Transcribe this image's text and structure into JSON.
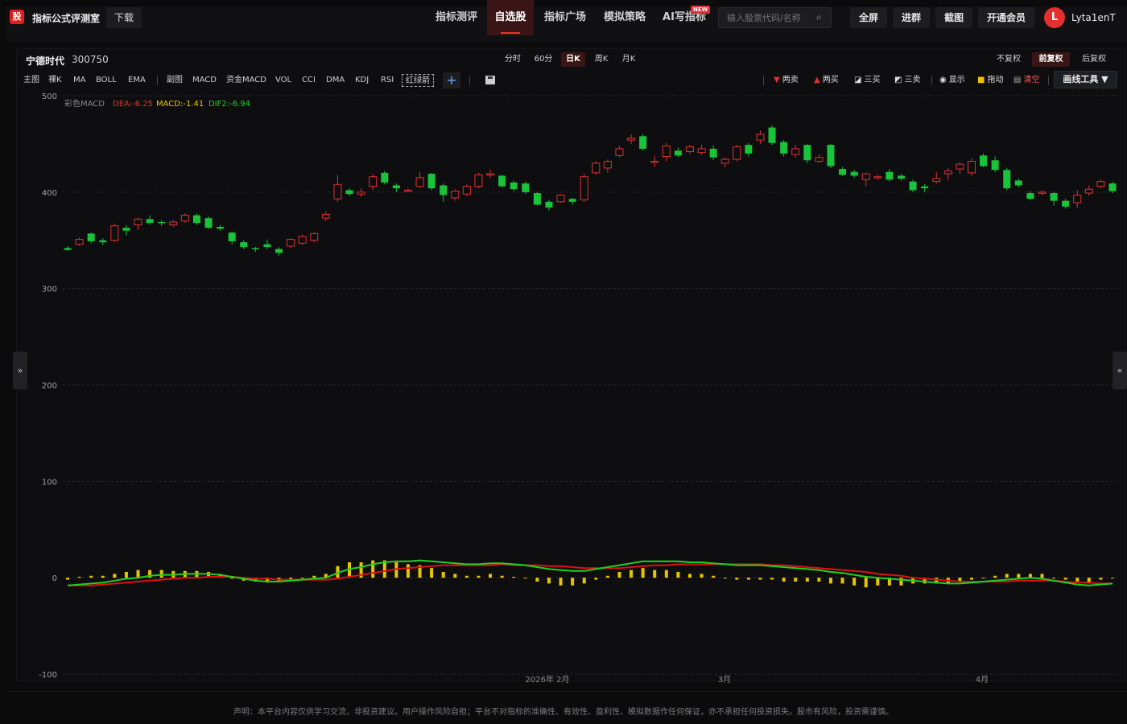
{
  "header": {
    "logo_char": "股",
    "site_title": "指标公式评测室",
    "download_label": "下载",
    "nav": [
      {
        "label": "指标测评",
        "active": false
      },
      {
        "label": "自选股",
        "active": true
      },
      {
        "label": "指标广场",
        "active": false
      },
      {
        "label": "模拟策略",
        "active": false
      },
      {
        "label": "AI写指标",
        "active": false
      }
    ],
    "new_badge": "NEW",
    "search_placeholder": "输入股票代码/名称",
    "buttons": [
      "全屏",
      "进群",
      "截图",
      "开通会员"
    ],
    "avatar_letter": "L",
    "username": "Lyta1enT"
  },
  "stock": {
    "name": "宁德时代",
    "code": "300750"
  },
  "periods": [
    {
      "label": "分时",
      "active": false
    },
    {
      "label": "60分",
      "active": false
    },
    {
      "label": "日K",
      "active": true
    },
    {
      "label": "周K",
      "active": false
    },
    {
      "label": "月K",
      "active": false
    }
  ],
  "adjust": [
    {
      "label": "不复权",
      "active": false
    },
    {
      "label": "前复权",
      "active": true
    },
    {
      "label": "后复权",
      "active": false
    }
  ],
  "indicators_main": [
    "主图",
    "裸K",
    "MA",
    "BOLL",
    "EMA"
  ],
  "indicators_sub": [
    "副图",
    "MACD",
    "资金MACD",
    "VOL",
    "CCI",
    "DMA",
    "KDJ",
    "RSI",
    "红绿箭"
  ],
  "tools": {
    "sell2": "两卖",
    "buy2": "两买",
    "buy3": "三买",
    "sell3": "三卖",
    "show": "显示",
    "drag": "拖动",
    "clear": "清空",
    "drawing": "画线工具 ▼"
  },
  "chart_data": {
    "type": "candlestick",
    "y_ticks": [
      "500",
      "400",
      "300",
      "200",
      "100",
      "0",
      "-100"
    ],
    "ylim": [
      -100,
      500
    ],
    "x_labels": [
      "2026年 2月",
      "3月",
      "4月"
    ],
    "legend": {
      "title": "彩色MACD",
      "dea": "DEA:-6.25",
      "macd": "MACD:-1.41",
      "dif": "DIF2:-6.94"
    },
    "up_color": "#e03030",
    "down_color": "#19c33a",
    "dif_color": "#20d020",
    "dea_color": "#e01010",
    "hist_color": "#e8c400",
    "candles": [
      [
        342,
        340,
        344,
        339
      ],
      [
        346,
        351,
        353,
        344
      ],
      [
        357,
        349,
        358,
        347
      ],
      [
        350,
        348,
        352,
        345
      ],
      [
        350,
        365,
        367,
        348
      ],
      [
        363,
        360,
        366,
        355
      ],
      [
        366,
        372,
        374,
        361
      ],
      [
        372,
        368,
        376,
        366
      ],
      [
        369,
        368,
        371,
        365
      ],
      [
        366,
        369,
        371,
        364
      ],
      [
        370,
        376,
        378,
        368
      ],
      [
        376,
        368,
        378,
        366
      ],
      [
        373,
        363,
        375,
        362
      ],
      [
        364,
        362,
        366,
        360
      ],
      [
        358,
        349,
        359,
        346
      ],
      [
        348,
        343,
        350,
        341
      ],
      [
        342,
        341,
        343,
        338
      ],
      [
        346,
        343,
        351,
        341
      ],
      [
        341,
        337,
        343,
        334
      ],
      [
        344,
        351,
        352,
        342
      ],
      [
        347,
        354,
        356,
        345
      ],
      [
        350,
        357,
        358,
        348
      ],
      [
        373,
        377,
        380,
        370
      ],
      [
        393,
        408,
        418,
        390
      ],
      [
        402,
        398,
        404,
        396
      ],
      [
        398,
        400,
        404,
        395
      ],
      [
        406,
        416,
        419,
        402
      ],
      [
        420,
        410,
        422,
        408
      ],
      [
        407,
        404,
        409,
        400
      ],
      [
        402,
        402,
        404,
        400
      ],
      [
        406,
        415,
        421,
        404
      ],
      [
        419,
        404,
        420,
        402
      ],
      [
        407,
        397,
        409,
        390
      ],
      [
        394,
        401,
        403,
        391
      ],
      [
        398,
        406,
        408,
        396
      ],
      [
        406,
        418,
        420,
        404
      ],
      [
        418,
        419,
        423,
        415
      ],
      [
        417,
        406,
        418,
        405
      ],
      [
        410,
        403,
        412,
        401
      ],
      [
        409,
        400,
        411,
        398
      ],
      [
        399,
        387,
        400,
        386
      ],
      [
        390,
        384,
        392,
        381
      ],
      [
        390,
        397,
        398,
        389
      ],
      [
        393,
        390,
        394,
        387
      ],
      [
        392,
        416,
        419,
        390
      ],
      [
        420,
        430,
        432,
        418
      ],
      [
        425,
        432,
        434,
        420
      ],
      [
        438,
        445,
        448,
        436
      ],
      [
        454,
        456,
        460,
        450
      ],
      [
        458,
        445,
        460,
        443
      ],
      [
        432,
        432,
        438,
        426
      ],
      [
        437,
        448,
        451,
        432
      ],
      [
        443,
        438,
        446,
        436
      ],
      [
        442,
        447,
        449,
        440
      ],
      [
        441,
        445,
        449,
        439
      ],
      [
        445,
        436,
        448,
        433
      ],
      [
        430,
        434,
        436,
        426
      ],
      [
        434,
        447,
        449,
        432
      ],
      [
        449,
        440,
        451,
        437
      ],
      [
        454,
        460,
        464,
        450
      ],
      [
        467,
        451,
        469,
        449
      ],
      [
        452,
        440,
        454,
        437
      ],
      [
        439,
        445,
        449,
        436
      ],
      [
        449,
        433,
        450,
        430
      ],
      [
        432,
        436,
        439,
        430
      ],
      [
        449,
        427,
        450,
        425
      ],
      [
        424,
        418,
        426,
        417
      ],
      [
        421,
        417,
        423,
        415
      ],
      [
        413,
        419,
        420,
        406
      ],
      [
        416,
        416,
        418,
        413
      ],
      [
        421,
        413,
        424,
        411
      ],
      [
        417,
        414,
        419,
        412
      ],
      [
        411,
        402,
        413,
        400
      ],
      [
        406,
        404,
        408,
        400
      ],
      [
        411,
        414,
        421,
        409
      ],
      [
        419,
        422,
        425,
        412
      ],
      [
        424,
        429,
        431,
        419
      ],
      [
        420,
        432,
        435,
        417
      ],
      [
        438,
        427,
        440,
        426
      ],
      [
        433,
        423,
        437,
        421
      ],
      [
        423,
        404,
        425,
        402
      ],
      [
        412,
        407,
        414,
        405
      ],
      [
        399,
        393,
        401,
        392
      ],
      [
        400,
        400,
        402,
        397
      ],
      [
        399,
        391,
        400,
        386
      ],
      [
        391,
        385,
        393,
        383
      ],
      [
        389,
        397,
        402,
        384
      ],
      [
        399,
        403,
        407,
        396
      ],
      [
        406,
        411,
        413,
        404
      ],
      [
        409,
        401,
        411,
        399
      ]
    ],
    "dif": [
      -8,
      -7,
      -6,
      -5,
      -3,
      -1,
      0,
      2,
      3,
      3,
      4,
      4,
      4,
      3,
      1,
      -1,
      -3,
      -4,
      -4,
      -3,
      -2,
      -1,
      0,
      5,
      9,
      11,
      14,
      16,
      17,
      17,
      18,
      17,
      16,
      15,
      14,
      14,
      15,
      15,
      14,
      13,
      11,
      9,
      8,
      7,
      7,
      9,
      11,
      13,
      15,
      17,
      17,
      17,
      17,
      16,
      16,
      15,
      14,
      13,
      13,
      13,
      12,
      11,
      10,
      9,
      8,
      6,
      5,
      3,
      1,
      0,
      -1,
      -2,
      -3,
      -4,
      -5,
      -6,
      -6,
      -5,
      -4,
      -3,
      -2,
      -1,
      0,
      -1,
      -3,
      -5,
      -7,
      -8,
      -7,
      -6
    ],
    "dea": [
      -8,
      -8,
      -8,
      -7,
      -6,
      -5,
      -4,
      -3,
      -2,
      -1,
      0,
      0,
      1,
      1,
      1,
      0,
      -1,
      -1,
      -2,
      -2,
      -2,
      -2,
      -2,
      -1,
      1,
      3,
      5,
      7,
      9,
      10,
      11,
      12,
      13,
      13,
      13,
      13,
      13,
      14,
      13,
      13,
      13,
      12,
      12,
      11,
      10,
      10,
      10,
      10,
      11,
      12,
      13,
      13,
      14,
      14,
      14,
      14,
      14,
      14,
      14,
      14,
      13,
      13,
      12,
      11,
      10,
      9,
      8,
      7,
      6,
      4,
      3,
      2,
      0,
      -1,
      -2,
      -3,
      -4,
      -4,
      -4,
      -4,
      -4,
      -3,
      -3,
      -3,
      -3,
      -4,
      -5,
      -5,
      -6,
      -6
    ],
    "macd": [
      -2,
      1,
      2,
      2,
      4,
      6,
      8,
      8,
      8,
      7,
      7,
      7,
      6,
      4,
      -1,
      -3,
      -4,
      -5,
      -4,
      -2,
      0,
      2,
      4,
      12,
      16,
      16,
      18,
      18,
      16,
      14,
      13,
      10,
      6,
      4,
      2,
      2,
      4,
      2,
      1,
      0,
      -4,
      -6,
      -8,
      -8,
      -6,
      -2,
      2,
      6,
      8,
      10,
      8,
      8,
      6,
      4,
      4,
      2,
      0,
      -2,
      -2,
      -2,
      -2,
      -4,
      -4,
      -4,
      -4,
      -6,
      -6,
      -8,
      -10,
      -8,
      -8,
      -8,
      -6,
      -6,
      -6,
      -6,
      -4,
      -2,
      0,
      2,
      4,
      4,
      4,
      4,
      0,
      -2,
      -4,
      -6,
      -2,
      0
    ]
  },
  "disclaimer": "声明：本平台内容仅供学习交流，非投资建议。用户操作风险自担；平台不对指标的准确性、有效性、盈利性、模拟数据作任何保证，亦不承担任何投资损失。股市有风险，投资需谨慎。"
}
